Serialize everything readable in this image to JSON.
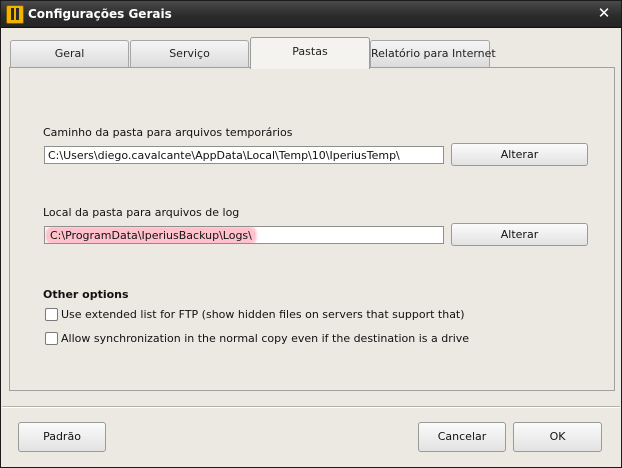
{
  "window": {
    "title": "Configurações Gerais"
  },
  "tabs": [
    {
      "label": "Geral",
      "active": false
    },
    {
      "label": "Serviço",
      "active": false
    },
    {
      "label": "Pastas",
      "active": true
    },
    {
      "label": "Relatório para Internet",
      "active": false
    }
  ],
  "temp_folder": {
    "label": "Caminho da pasta para arquivos temporários",
    "value": "C:\\Users\\diego.cavalcante\\AppData\\Local\\Temp\\10\\IperiusTemp\\",
    "button": "Alterar"
  },
  "log_folder": {
    "label": "Local da pasta para arquivos de log",
    "value": "C:\\ProgramData\\IperiusBackup\\Logs\\",
    "button": "Alterar"
  },
  "other_options": {
    "heading": "Other options",
    "options": [
      {
        "label": "Use extended list for FTP (show hidden files on servers that support that)",
        "checked": false
      },
      {
        "label": "Allow synchronization in the normal copy even if the destination is a drive",
        "checked": false
      }
    ]
  },
  "footer": {
    "default_button": "Padrão",
    "cancel_button": "Cancelar",
    "ok_button": "OK"
  },
  "icons": {
    "app": "iperius-app-icon",
    "close": "close-icon"
  }
}
